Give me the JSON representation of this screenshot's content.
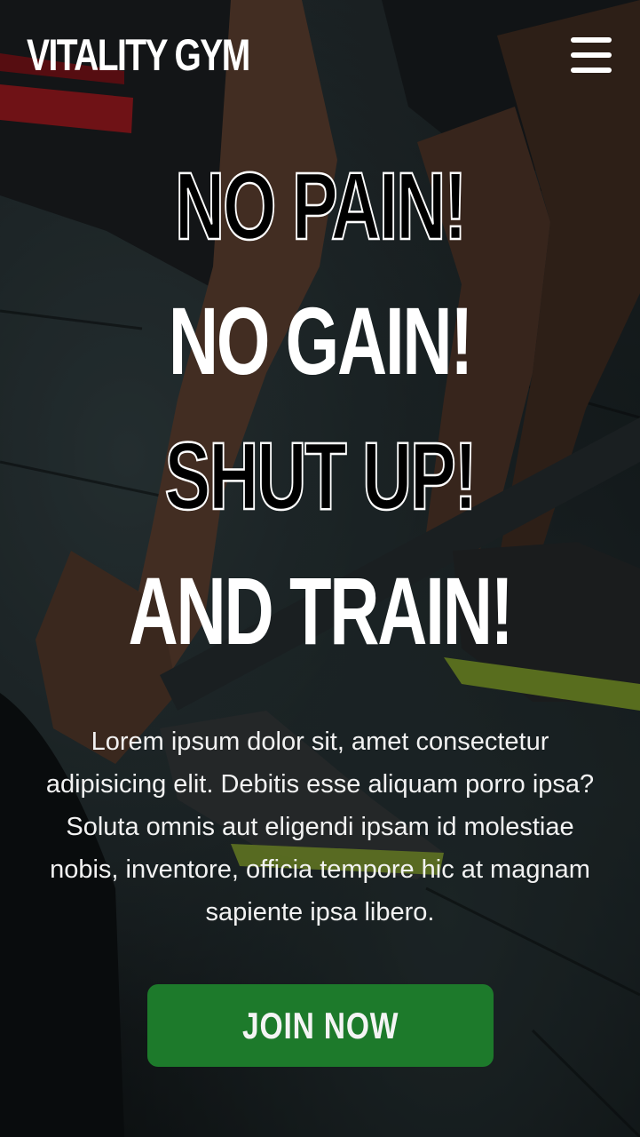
{
  "header": {
    "brand": "VITALITY GYM",
    "menu_icon": "hamburger-menu-icon"
  },
  "hero": {
    "line1": "NO PAIN!",
    "line2": "NO GAIN!",
    "line3": "SHUT UP!",
    "line4": "AND TRAIN!",
    "description": "Lorem ipsum dolor sit, amet consectetur adipisicing elit. Debitis esse aliquam porro ipsa? Soluta omnis aut eligendi ipsam id molestiae nobis, inventore, officia tempore hic at magnam sapiente ipsa libero.",
    "cta_label": "JOIN NOW"
  },
  "colors": {
    "cta_background": "#1d7a2b",
    "text": "#ffffff",
    "shoe_accent": "#a6c93a",
    "shorts_stripe": "#c8202a"
  }
}
